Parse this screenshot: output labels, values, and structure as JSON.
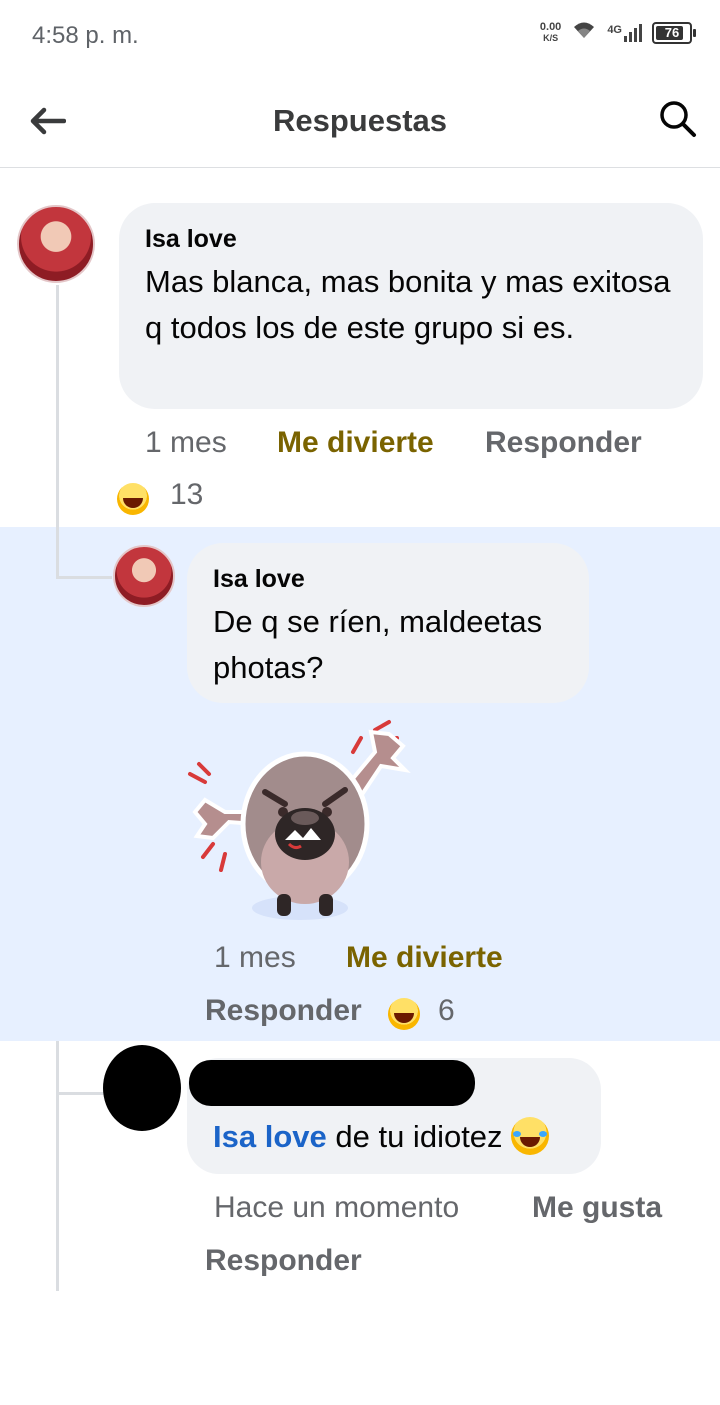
{
  "status_bar": {
    "time": "4:58 p. m.",
    "net_speed_value": "0.00",
    "net_speed_unit": "K/S",
    "network_type": "4G",
    "battery_level": "76"
  },
  "header": {
    "title": "Respuestas"
  },
  "comments": [
    {
      "author": "Isa love",
      "text": "Mas blanca, mas bonita y mas exitosa q todos los de este grupo si es.",
      "time": "1 mes",
      "reaction_label": "Me divierte",
      "reply_label": "Responder",
      "reaction_count": "13"
    },
    {
      "author": "Isa love",
      "text": "De q se ríen, maldeetas photas?",
      "time": "1 mes",
      "reaction_label": "Me divierte",
      "reply_label": "Responder",
      "reaction_count": "6"
    },
    {
      "mention": "Isa love",
      "text": "de tu idiotez",
      "time": "Hace un momento",
      "reaction_label": "Me gusta",
      "reply_label": "Responder"
    }
  ]
}
